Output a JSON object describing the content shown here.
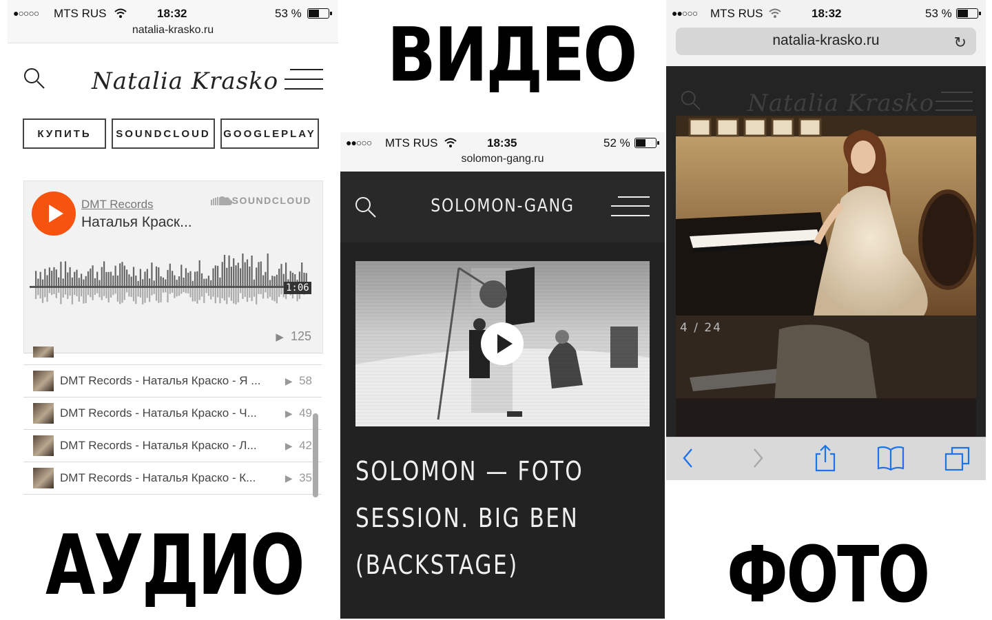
{
  "labels": {
    "video": "ВИДЕО",
    "audio": "АУДИО",
    "photo": "ФОТО"
  },
  "left_phone": {
    "status": {
      "carrier": "MTS RUS",
      "time": "18:32",
      "battery": "53 %",
      "signal": "●○○○○"
    },
    "url": "natalia-krasko.ru",
    "logo": "Natalia Krasko",
    "buttons": [
      "КУПИТЬ",
      "SOUNDCLOUD",
      "GOOGLEPLAY"
    ],
    "player": {
      "artist": "DMT Records",
      "title": "Наталья Краск...",
      "brand": "SOUNDCLOUD",
      "time": "1:06",
      "plays": "125"
    },
    "tracks": [
      {
        "text": "DMT Records - Наталья Краско - Я ...",
        "plays": "58"
      },
      {
        "text": "DMT Records - Наталья Краско - Ч...",
        "plays": "49"
      },
      {
        "text": "DMT Records - Наталья Краско - Л...",
        "plays": "42"
      },
      {
        "text": "DMT Records - Наталья Краско - К...",
        "plays": "35"
      }
    ]
  },
  "mid_phone": {
    "status": {
      "carrier": "MTS RUS",
      "time": "18:35",
      "battery": "52 %",
      "signal": "●●○○○"
    },
    "url": "solomon-gang.ru",
    "site_title": "SOLOMON-GANG",
    "video_title": "SOLOMON — FOTO SESSION. BIG BEN (BACKSTAGE)"
  },
  "right_phone": {
    "status": {
      "carrier": "MTS RUS",
      "time": "18:32",
      "battery": "53 %",
      "signal": "●●○○○"
    },
    "url": "natalia-krasko.ru",
    "logo": "Natalia Krasko",
    "counter": "4 / 24"
  },
  "colors": {
    "soundcloud_orange": "#f5530f",
    "dark_site": "#222222"
  }
}
